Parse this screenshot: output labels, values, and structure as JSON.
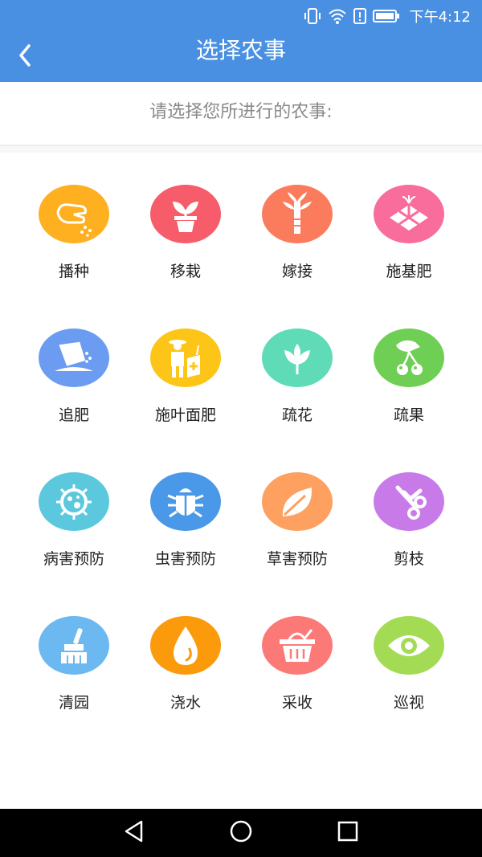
{
  "status_bar": {
    "time": "下午4:12",
    "icons": [
      "vibrate-icon",
      "wifi-icon",
      "alert-icon",
      "battery-icon"
    ]
  },
  "header": {
    "title": "选择农事",
    "back_icon": "chevron-left-icon",
    "background": "#4a90e2"
  },
  "prompt": "请选择您所进行的农事:",
  "tasks": [
    {
      "label": "播种",
      "icon": "sowing-hand-icon",
      "color": "#ffb020"
    },
    {
      "label": "移栽",
      "icon": "potted-plant-icon",
      "color": "#f65c69"
    },
    {
      "label": "嫁接",
      "icon": "grafting-icon",
      "color": "#fb7b5d"
    },
    {
      "label": "施基肥",
      "icon": "fertilizer-field-icon",
      "color": "#f86d9c"
    },
    {
      "label": "追肥",
      "icon": "fertilizer-bag-icon",
      "color": "#6c9cf2"
    },
    {
      "label": "施叶面肥",
      "icon": "farmer-icon",
      "color": "#fdc518"
    },
    {
      "label": "疏花",
      "icon": "flower-icon",
      "color": "#5fdcb7"
    },
    {
      "label": "疏果",
      "icon": "cherry-icon",
      "color": "#6fcf55"
    },
    {
      "label": "病害预防",
      "icon": "virus-icon",
      "color": "#5bc8dd"
    },
    {
      "label": "虫害预防",
      "icon": "bug-icon",
      "color": "#4a98e8"
    },
    {
      "label": "草害预防",
      "icon": "leaf-icon",
      "color": "#fda060"
    },
    {
      "label": "剪枝",
      "icon": "scissors-icon",
      "color": "#c87be8"
    },
    {
      "label": "清园",
      "icon": "broom-icon",
      "color": "#6cb8f0"
    },
    {
      "label": "浇水",
      "icon": "water-drop-icon",
      "color": "#fb9a0a"
    },
    {
      "label": "采收",
      "icon": "basket-icon",
      "color": "#fb7a78"
    },
    {
      "label": "巡视",
      "icon": "eye-icon",
      "color": "#a3dc54"
    }
  ],
  "nav_bar": {
    "back_icon": "triangle-back-icon",
    "home_icon": "circle-home-icon",
    "recents_icon": "square-recents-icon"
  }
}
